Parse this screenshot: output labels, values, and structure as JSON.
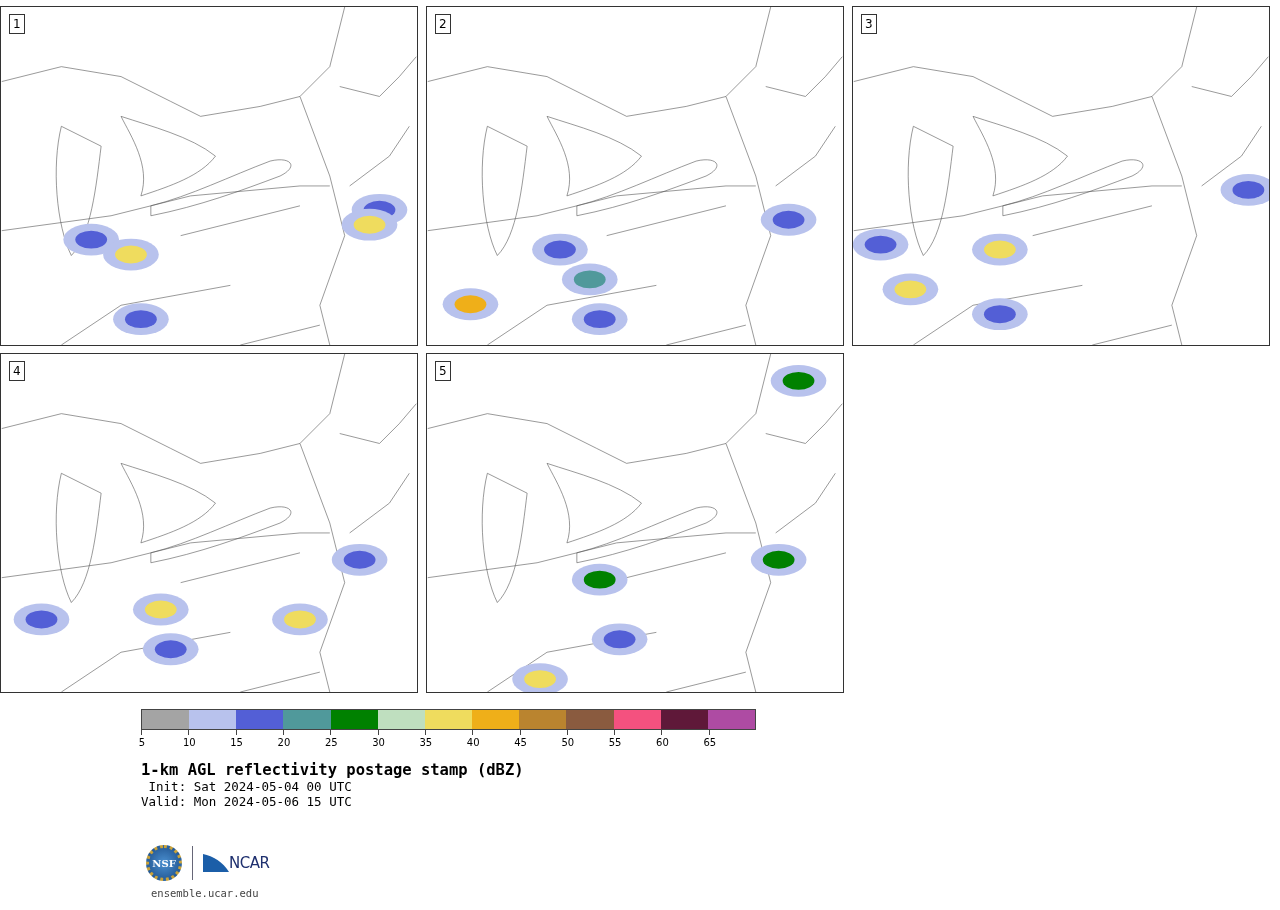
{
  "panels": [
    {
      "label": "1"
    },
    {
      "label": "2"
    },
    {
      "label": "3"
    },
    {
      "label": "4"
    },
    {
      "label": "5"
    }
  ],
  "colorbar": {
    "segments": [
      {
        "color": "#a4a4a4",
        "label": "5"
      },
      {
        "color": "#b8c2ed",
        "label": "10"
      },
      {
        "color": "#535fd6",
        "label": "15"
      },
      {
        "color": "#50999b",
        "label": "20"
      },
      {
        "color": "#008100",
        "label": "25"
      },
      {
        "color": "#bfdfbf",
        "label": "30"
      },
      {
        "color": "#efdc5e",
        "label": "35"
      },
      {
        "color": "#efaf19",
        "label": "40"
      },
      {
        "color": "#ba842f",
        "label": "45"
      },
      {
        "color": "#8a5b3f",
        "label": "50"
      },
      {
        "color": "#f4517f",
        "label": "55"
      },
      {
        "color": "#5f1839",
        "label": "60"
      },
      {
        "color": "#ae4ba3",
        "label": "65"
      }
    ]
  },
  "title": "1-km AGL reflectivity postage stamp (dBZ)",
  "init": " Init: Sat 2024-05-04 00 UTC",
  "valid": "Valid: Mon 2024-05-06 15 UTC",
  "logos": {
    "nsf": "NSF",
    "ncar": "NCAR"
  },
  "url": "ensemble.ucar.edu"
}
